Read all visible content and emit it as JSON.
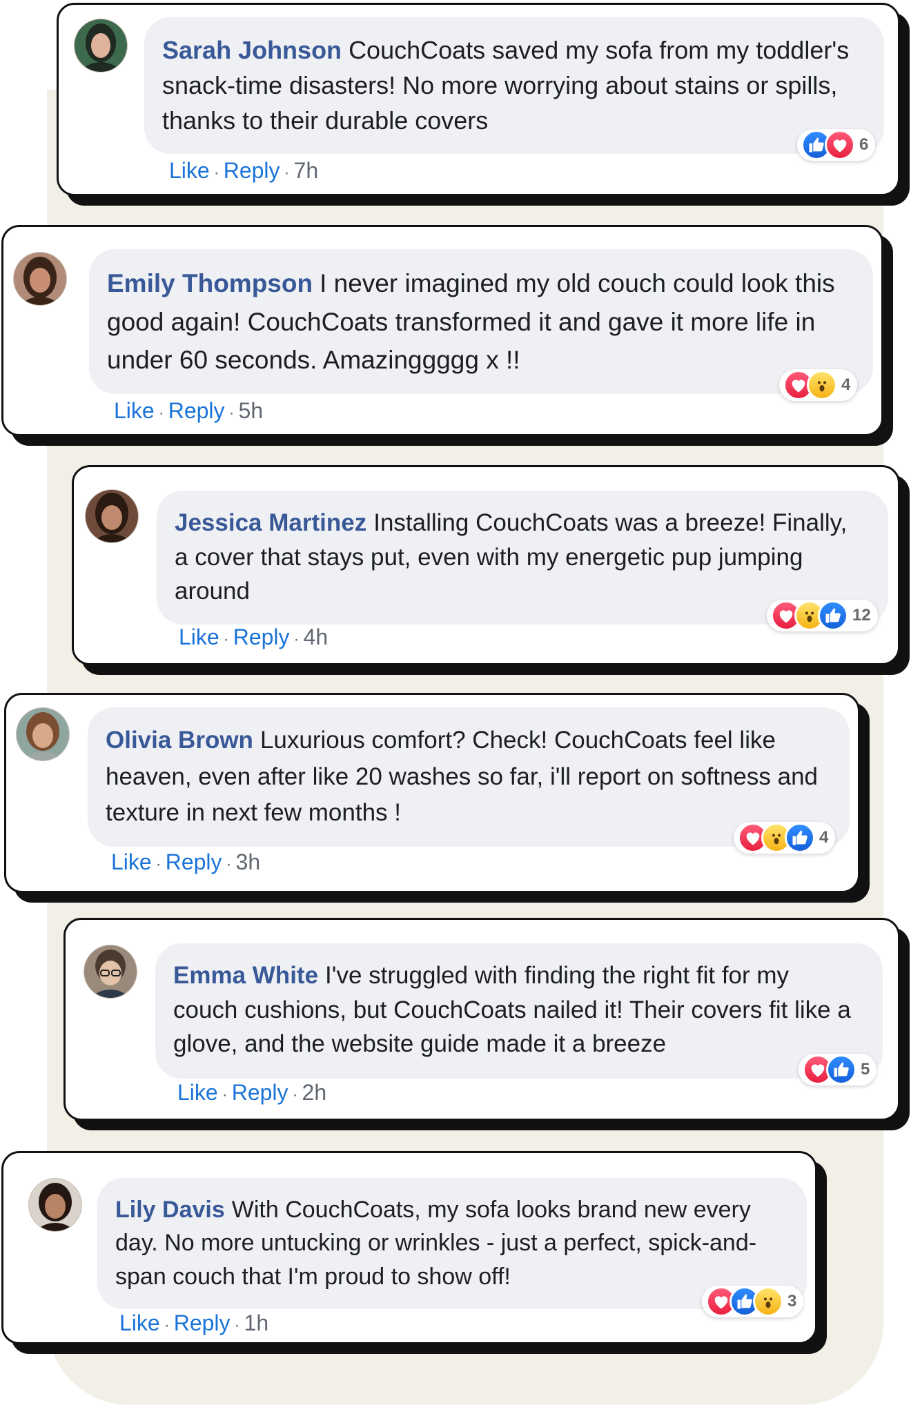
{
  "comments": [
    {
      "author": "Sarah Johnson",
      "text": "CouchCoats saved my sofa from my toddler's snack-time disasters! No more worrying about stains or spills, thanks to their durable covers",
      "like_label": "Like",
      "reply_label": "Reply",
      "time": "7h",
      "reactions": [
        "like-icon",
        "love-icon"
      ],
      "reaction_count": "6",
      "avatar_colors": {
        "bg": "#3d6a4c",
        "skin": "#e0b49c",
        "hair": "#1e2a22"
      }
    },
    {
      "author": "Emily Thompson",
      "text": "I never imagined my old couch could look this good again! CouchCoats transformed it and gave it more life in under 60 seconds. Amazinggggg x !!",
      "like_label": "Like",
      "reply_label": "Reply",
      "time": "5h",
      "reactions": [
        "love-icon",
        "wow-icon"
      ],
      "reaction_count": "4",
      "avatar_colors": {
        "bg": "#b28a78",
        "skin": "#c98f73",
        "hair": "#3a2418"
      }
    },
    {
      "author": "Jessica Martinez",
      "text": "Installing CouchCoats was a breeze! Finally, a cover that stays put, even with my energetic pup jumping around",
      "like_label": "Like",
      "reply_label": "Reply",
      "time": "4h",
      "reactions": [
        "love-icon",
        "wow-icon",
        "like-icon"
      ],
      "reaction_count": "12",
      "avatar_colors": {
        "bg": "#6d4a3a",
        "skin": "#c08a6e",
        "hair": "#2b1a12"
      }
    },
    {
      "author": "Olivia Brown",
      "text": "Luxurious comfort? Check! CouchCoats feel like heaven, even after like 20 washes so far, i'll report on softness and texture in next few months !",
      "like_label": "Like",
      "reply_label": "Reply",
      "time": "3h",
      "reactions": [
        "love-icon",
        "wow-icon",
        "like-icon"
      ],
      "reaction_count": "4",
      "avatar_colors": {
        "bg": "#8fa6a0",
        "skin": "#d9a98c",
        "hair": "#7a4e30"
      }
    },
    {
      "author": "Emma White",
      "text": "I've struggled with finding the right fit for my couch cushions, but CouchCoats nailed it! Their covers fit like a glove, and the website guide made it a breeze",
      "like_label": "Like",
      "reply_label": "Reply",
      "time": "2h",
      "reactions": [
        "love-icon",
        "like-icon"
      ],
      "reaction_count": "5",
      "avatar_colors": {
        "bg": "#9a8a7c",
        "skin": "#e2c2a8",
        "hair": "#4a3a30"
      }
    },
    {
      "author": "Lily Davis",
      "text": "With CouchCoats, my sofa looks brand new every day. No more untucking or wrinkles - just a perfect, spick-and-span couch that I'm proud to show off!",
      "like_label": "Like",
      "reply_label": "Reply",
      "time": "1h",
      "reactions": [
        "love-icon",
        "like-icon",
        "wow-icon"
      ],
      "reaction_count": "3",
      "avatar_colors": {
        "bg": "#d9d3cc",
        "skin": "#b88466",
        "hair": "#241610"
      }
    }
  ]
}
